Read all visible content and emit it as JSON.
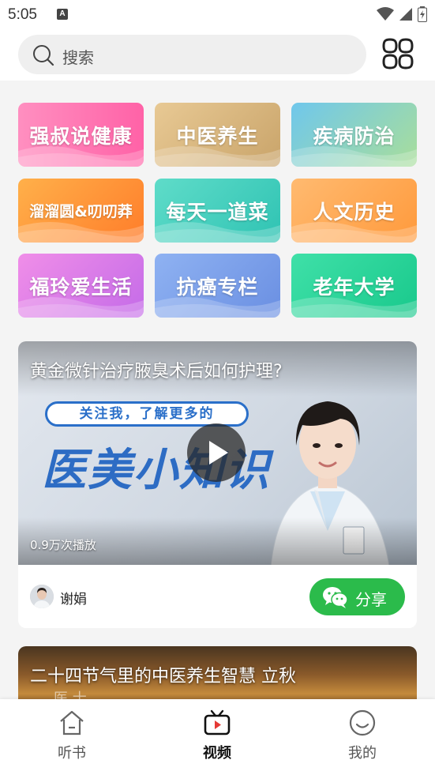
{
  "status_bar": {
    "time": "5:05",
    "notification_letter": "A"
  },
  "search": {
    "placeholder": "搜索"
  },
  "categories": [
    {
      "label": "强叔说健康",
      "color_from": "#ff8fc0",
      "color_to": "#ff62a7"
    },
    {
      "label": "中医养生",
      "color_from": "#e8c994",
      "color_to": "#c9a46a"
    },
    {
      "label": "疾病防治",
      "color_from": "#6fc7ec",
      "color_to": "#a9de9a"
    },
    {
      "label": "溜溜圆&叨叨莽",
      "color_from": "#ffb04a",
      "color_to": "#ff7d2a"
    },
    {
      "label": "每天一道菜",
      "color_from": "#5fdcc9",
      "color_to": "#2fc3b3"
    },
    {
      "label": "人文历史",
      "color_from": "#ffba70",
      "color_to": "#ff9a3c"
    },
    {
      "label": "福玲爱生活",
      "color_from": "#f08ee8",
      "color_to": "#c46be8"
    },
    {
      "label": "抗癌专栏",
      "color_from": "#8fb2f2",
      "color_to": "#6a8fe2"
    },
    {
      "label": "老年大学",
      "color_from": "#3fe0a8",
      "color_to": "#19c98c"
    }
  ],
  "video1": {
    "title": "黄金微针治疗腋臭术后如何护理?",
    "banner_pill": "关注我，了解更多的",
    "banner_big": "医美小知识",
    "play_count": "0.9万次播放",
    "author": "谢娟",
    "share_label": "分享"
  },
  "video2": {
    "title": "二十四节气里的中医养生智慧 立秋",
    "faint_text": "医 士"
  },
  "nav": {
    "items": [
      {
        "label": "听书",
        "active": false
      },
      {
        "label": "视频",
        "active": true
      },
      {
        "label": "我的",
        "active": false
      }
    ]
  },
  "colors": {
    "share_green": "#2bbb4b",
    "banner_blue": "#2a6fc9"
  }
}
